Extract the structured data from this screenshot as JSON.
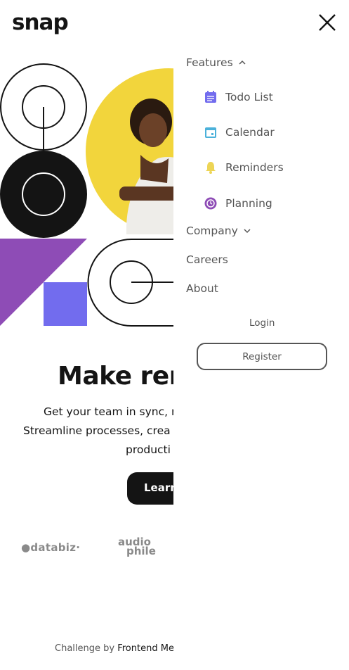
{
  "brand": {
    "logo": "snap"
  },
  "hero": {
    "headline": "Make rem",
    "description": [
      "Get your team in sync, r",
      "Streamline processes, crea",
      "producti"
    ],
    "cta_label": "Learn"
  },
  "clients": [
    {
      "name": "databiz",
      "label": "●databiz·"
    },
    {
      "name": "audiophile",
      "line1": "audio",
      "line2": "phile"
    }
  ],
  "attribution": {
    "prefix": "Challenge by ",
    "link": "Frontend Me"
  },
  "menu": {
    "features_label": "Features",
    "features_items": [
      {
        "label": "Todo List",
        "icon": "todo-list-icon",
        "color": "#726CEE"
      },
      {
        "label": "Calendar",
        "icon": "calendar-icon",
        "color": "#4BB1DA"
      },
      {
        "label": "Reminders",
        "icon": "bell-icon",
        "color": "#EDD556"
      },
      {
        "label": "Planning",
        "icon": "clock-icon",
        "color": "#8E4CB6"
      }
    ],
    "company_label": "Company",
    "careers_label": "Careers",
    "about_label": "About",
    "login_label": "Login",
    "register_label": "Register"
  },
  "colors": {
    "text_dark": "#141414",
    "text_gray": "#555555",
    "purple": "#8E4CB6",
    "violet": "#726CEE",
    "yellow": "#EDD556"
  }
}
